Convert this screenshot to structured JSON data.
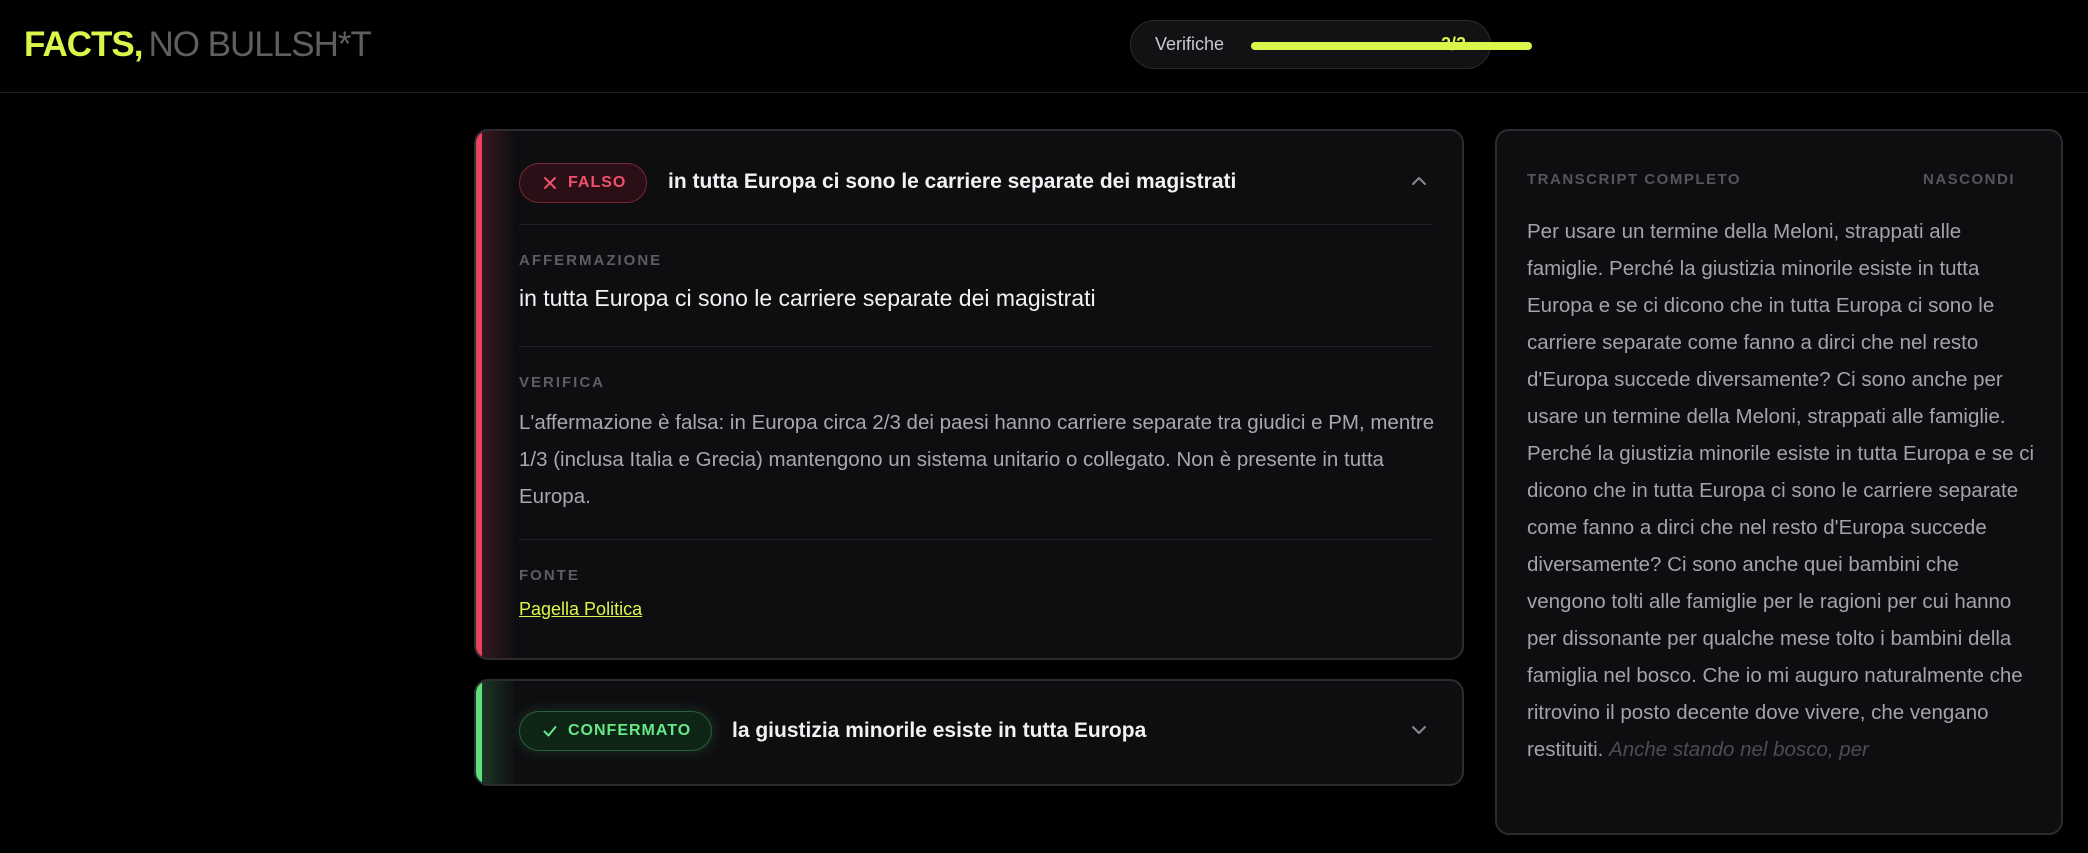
{
  "header": {
    "logo_primary": "FACTS,",
    "logo_secondary": "NO BULLSH*T",
    "progress_label": "Verifiche",
    "progress_count": "2/2",
    "progress_fraction": 1.0,
    "accent_color": "#d9f74a"
  },
  "cards": [
    {
      "verdict": "FALSO",
      "verdict_icon": "x-icon",
      "verdict_color": "#e8435c",
      "title": "in tutta Europa ci sono le carriere separate dei magistrati",
      "expanded": true,
      "claim_label": "AFFERMAZIONE",
      "claim": "in tutta Europa ci sono le carriere separate dei magistrati",
      "verification_label": "VERIFICA",
      "verification": "L'affermazione è falsa: in Europa circa 2/3 dei paesi hanno carriere separate tra giudici e PM, mentre 1/3 (inclusa Italia e Grecia) mantengono un sistema unitario o collegato. Non è presente in tutta Europa.",
      "source_label": "FONTE",
      "source": "Pagella Politica"
    },
    {
      "verdict": "CONFERMATO",
      "verdict_icon": "check-icon",
      "verdict_color": "#5ee07d",
      "title": "la giustizia minorile esiste in tutta Europa",
      "expanded": false
    }
  ],
  "transcript": {
    "title": "TRANSCRIPT COMPLETO",
    "hide_label": "NASCONDI",
    "text": "Per usare un termine della Meloni, strappati alle famiglie. Perché la giustizia minorile esiste in tutta Europa e se ci dicono che in tutta Europa ci sono le carriere separate come fanno a dirci che nel resto d'Europa succede diversamente? Ci sono anche per usare un termine della Meloni, strappati alle famiglie. Perché la giustizia minorile esiste in tutta Europa e se ci dicono che in tutta Europa ci sono le carriere separate come fanno a dirci che nel resto d'Europa succede diversamente? Ci sono anche quei bambini che vengono tolti alle famiglie per le ragioni per cui hanno per dissonante per qualche mese tolto i bambini della famiglia nel bosco. Che io mi auguro naturalmente che ritrovino il posto decente dove vivere, che vengano restituiti.",
    "live_text": "Anche stando nel bosco, per"
  }
}
